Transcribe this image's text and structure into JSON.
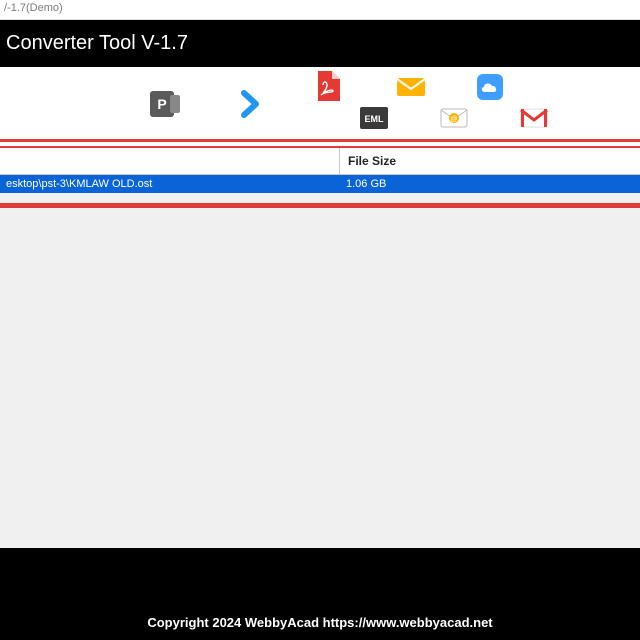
{
  "window": {
    "title_fragment": "/-1.7(Demo)"
  },
  "app": {
    "header_title": "Converter Tool V-1.7"
  },
  "table": {
    "headers": {
      "file_size": "File Size"
    },
    "rows": [
      {
        "path": "esktop\\pst-3\\KMLAW OLD.ost",
        "size": "1.06 GB"
      }
    ]
  },
  "footer": {
    "copyright": "Copyright 2024 WebbyAcad https://www.webbyacad.net"
  },
  "icons": {
    "pst": "pst-icon",
    "arrow": "arrow-right-icon",
    "pdf": "pdf-icon",
    "mail": "mail-envelope-icon",
    "cloud": "icloud-icon",
    "eml": "eml-icon",
    "envelope": "yellow-envelope-icon",
    "gmail": "gmail-icon"
  }
}
